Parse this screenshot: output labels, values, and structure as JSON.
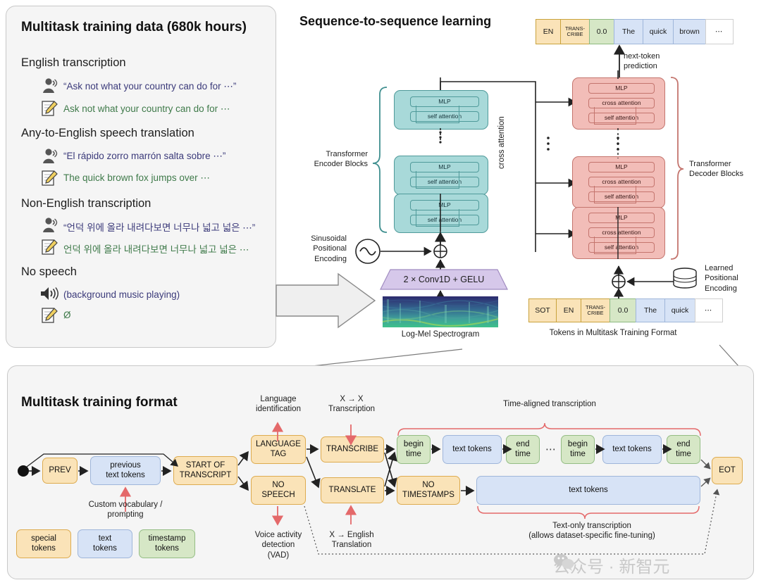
{
  "panels": {
    "left": {
      "title": "Multitask training data (680k hours)",
      "groups": [
        {
          "heading": "English transcription",
          "speech": "“Ask not what your country can do for ⋯”",
          "text": "Ask not what your country can do for ⋯",
          "speech_icon": "speaking-person-icon",
          "text_icon": "note-pencil-icon"
        },
        {
          "heading": "Any-to-English speech translation",
          "speech": "“El rápido zorro marrón salta sobre ⋯”",
          "text": "The quick brown fox jumps over ⋯",
          "speech_icon": "speaking-person-icon",
          "text_icon": "note-pencil-icon"
        },
        {
          "heading": "Non-English transcription",
          "speech": "“언덕 위에 올라 내려다보면 너무나 넓고 넓은 ⋯”",
          "text": "언덕 위에 올라 내려다보면 너무나 넓고 넓은 ⋯",
          "speech_icon": "speaking-person-icon",
          "text_icon": "note-pencil-icon"
        },
        {
          "heading": "No speech",
          "speech": "(background music playing)",
          "text": "Ø",
          "speech_icon": "speaker-sound-icon",
          "text_icon": "note-pencil-icon"
        }
      ]
    },
    "middle": {
      "title": "Sequence-to-sequence learning",
      "output_tokens": [
        {
          "label": "EN",
          "kind": "special"
        },
        {
          "label": "TRANS-\nCRIBE",
          "kind": "special"
        },
        {
          "label": "0.0",
          "kind": "timestamp"
        },
        {
          "label": "The",
          "kind": "text"
        },
        {
          "label": "quick",
          "kind": "text"
        },
        {
          "label": "brown",
          "kind": "text"
        },
        {
          "label": "⋯",
          "kind": "ellipsis"
        }
      ],
      "input_tokens": [
        {
          "label": "SOT",
          "kind": "special"
        },
        {
          "label": "EN",
          "kind": "special"
        },
        {
          "label": "TRANS-\nCRIBE",
          "kind": "special"
        },
        {
          "label": "0.0",
          "kind": "timestamp"
        },
        {
          "label": "The",
          "kind": "text"
        },
        {
          "label": "quick",
          "kind": "text"
        },
        {
          "label": "⋯",
          "kind": "ellipsis"
        }
      ],
      "next_token_prediction": "next-token\nprediction",
      "cross_attention": "cross attention",
      "encoder_brace": "Transformer\nEncoder Blocks",
      "decoder_brace": "Transformer\nDecoder Blocks",
      "sinusoidal_pe": "Sinusoidal\nPositional\nEncoding",
      "learned_pe": "Learned\nPositional\nEncoding",
      "conv_stem": "2 × Conv1D + GELU",
      "spectrogram_caption": "Log-Mel Spectrogram",
      "tokens_caption": "Tokens in Multitask Training Format",
      "block_layers": {
        "mlp": "MLP",
        "self_attention": "self attention",
        "cross_attention": "cross attention"
      }
    },
    "bottom": {
      "title": "Multitask training format",
      "nodes": {
        "prev": "PREV",
        "previous_text_tokens": "previous\ntext tokens",
        "start_of_transcript": "START OF\nTRANSCRIPT",
        "language_tag": "LANGUAGE\nTAG",
        "no_speech": "NO\nSPEECH",
        "transcribe": "TRANSCRIBE",
        "translate": "TRANSLATE",
        "no_timestamps": "NO\nTIMESTAMPS",
        "begin_time_1": "begin\ntime",
        "text_tokens_1": "text tokens",
        "end_time_1": "end\ntime",
        "begin_time_2": "begin\ntime",
        "text_tokens_2": "text tokens",
        "end_time_2": "end\ntime",
        "text_tokens_long": "text tokens",
        "eot": "EOT",
        "ellipsis": "⋯"
      },
      "annotations": {
        "custom_vocab": "Custom vocabulary /\nprompting",
        "language_identification": "Language\nidentification",
        "x_to_x": "X → X\nTranscription",
        "vad": "Voice activity\ndetection\n(VAD)",
        "x_to_english": "X → English\nTranslation",
        "time_aligned": "Time-aligned transcription",
        "text_only": "Text-only transcription\n(allows dataset-specific fine-tuning)"
      },
      "legend": [
        {
          "label": "special\ntokens",
          "kind": "special"
        },
        {
          "label": "text\ntokens",
          "kind": "text"
        },
        {
          "label": "timestamp\ntokens",
          "kind": "timestamp"
        }
      ]
    }
  },
  "watermark": "公众号 · 新智元",
  "colors": {
    "special_fill": "#fae3b8",
    "special_stroke": "#ddab4f",
    "text_fill": "#d7e3f6",
    "text_stroke": "#9fb6da",
    "timestamp_fill": "#d6e7c6",
    "timestamp_stroke": "#94bd84",
    "encoder_fill": "#a8d9d9",
    "encoder_stroke": "#4f9a9a",
    "decoder_fill": "#f2bdb8",
    "decoder_stroke": "#c4756e",
    "conv_fill": "#d6c8ea",
    "accent_red": "#d9534f",
    "panel_bg": "#f5f5f5",
    "speech_text": "#3b3a7a",
    "transcript_text": "#3f7a4a"
  }
}
